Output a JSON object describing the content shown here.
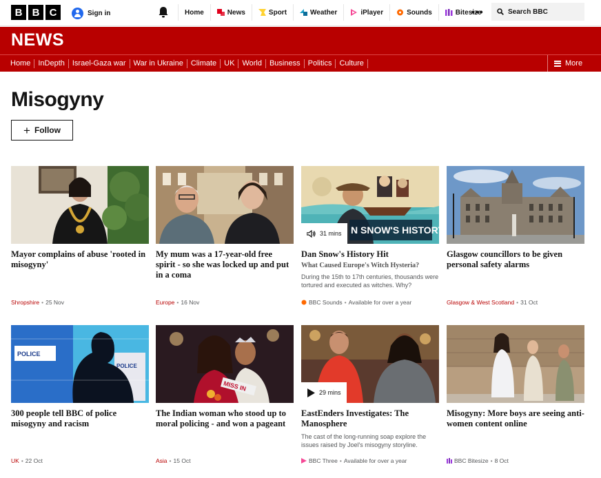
{
  "header": {
    "logo": [
      "B",
      "B",
      "C"
    ],
    "sign_in": "Sign in",
    "nav": [
      {
        "label": "Home",
        "icon": "none"
      },
      {
        "label": "News",
        "icon": "news-icon",
        "color": "#e0001b"
      },
      {
        "label": "Sport",
        "icon": "sport-icon",
        "color": "#ffd230"
      },
      {
        "label": "Weather",
        "icon": "weather-icon",
        "color": "#1da1c9"
      },
      {
        "label": "iPlayer",
        "icon": "iplayer-icon",
        "color": "#f54996"
      },
      {
        "label": "Sounds",
        "icon": "sounds-icon",
        "color": "#ff6900"
      },
      {
        "label": "Bitesize",
        "icon": "bitesize-icon",
        "color": "#9b37dc"
      }
    ],
    "more": "•••",
    "search_placeholder": "Search BBC"
  },
  "masthead": {
    "title": "NEWS",
    "nav": [
      "Home",
      "InDepth",
      "Israel-Gaza war",
      "War in Ukraine",
      "Climate",
      "UK",
      "World",
      "Business",
      "Politics",
      "Culture"
    ],
    "more": "More"
  },
  "topic": {
    "title": "Misogyny",
    "follow": "Follow"
  },
  "cards": [
    {
      "headline": "Mayor complains of abuse 'rooted in misogyny'",
      "tag": "Shropshire",
      "date": "25 Nov"
    },
    {
      "headline": "My mum was a 17-year-old free spirit - so she was locked up and put in a coma",
      "tag": "Europe",
      "date": "16 Nov"
    },
    {
      "headline": "Dan Snow's History Hit",
      "subhead": "What Caused Europe's Witch Hysteria?",
      "desc": "During the 15th to 17th centuries, thousands were tortured and executed as witches. Why?",
      "duration": "31 mins",
      "source": "BBC Sounds",
      "availability": "Available for over a year",
      "image_text": "N SNOW'S HISTORY HIT"
    },
    {
      "headline": "Glasgow councillors to be given personal safety alarms",
      "tag": "Glasgow & West Scotland",
      "date": "31 Oct"
    },
    {
      "headline": "300 people tell BBC of police misogyny and racism",
      "tag": "UK",
      "date": "22 Oct",
      "image_text": [
        "POLICE",
        "POLICE"
      ]
    },
    {
      "headline": "The Indian woman who stood up to moral policing - and won a pageant",
      "tag": "Asia",
      "date": "15 Oct",
      "image_text": "MISS IN"
    },
    {
      "headline": "EastEnders Investigates: The Manosphere",
      "desc": "The cast of the long-running soap explore the issues raised by Joel's misogyny storyline.",
      "duration": "29 mins",
      "source": "BBC Three",
      "availability": "Available for over a year"
    },
    {
      "headline": "Misogyny: More boys are seeing anti-women content online",
      "source": "BBC Bitesize",
      "date": "8 Oct"
    }
  ],
  "colors": {
    "brand_red": "#b80000",
    "text": "#141414",
    "meta": "#545658"
  }
}
